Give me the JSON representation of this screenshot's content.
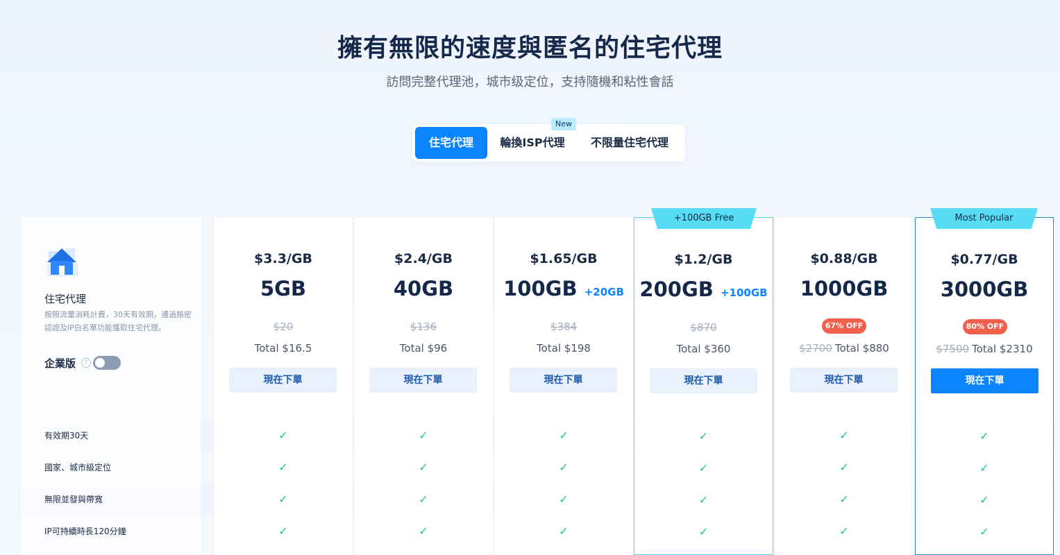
{
  "hero": {
    "title": "擁有無限的速度與匿名的住宅代理",
    "subtitle": "訪問完整代理池，城市级定位，支持隨機和粘性會話"
  },
  "tabs": [
    {
      "label": "住宅代理",
      "active": true
    },
    {
      "label": "輪換ISP代理",
      "active": false,
      "badge": "New"
    },
    {
      "label": "不限量住宅代理",
      "active": false
    }
  ],
  "product": {
    "icon": "house-icon",
    "title": "住宅代理",
    "description": "按照流量消耗計費，30天有效期，通過賬密認證及IP白名單功能獲取住宅代理。",
    "enterprise_label": "企業版",
    "enterprise_toggle": false
  },
  "features": [
    "有效期30天",
    "國家、城市級定位",
    "無限並發與帶寬",
    "IP可持續時長120分鐘"
  ],
  "plans": [
    {
      "per": "$3.3/GB",
      "size": "5GB",
      "bonus": "",
      "original": "$20",
      "discount": "",
      "total": "Total $16.5",
      "buy": "現在下單"
    },
    {
      "per": "$2.4/GB",
      "size": "40GB",
      "bonus": "",
      "original": "$136",
      "discount": "",
      "total": "Total $96",
      "buy": "現在下單"
    },
    {
      "per": "$1.65/GB",
      "size": "100GB",
      "bonus": "+20GB",
      "original": "$384",
      "discount": "",
      "total": "Total $198",
      "buy": "現在下單"
    },
    {
      "per": "$1.2/GB",
      "size": "200GB",
      "bonus": "+100GB",
      "original": "$870",
      "discount": "",
      "total": "Total $360",
      "buy": "現在下單",
      "ribbon": "+100GB Free"
    },
    {
      "per": "$0.88/GB",
      "size": "1000GB",
      "bonus": "",
      "original": "$2700",
      "discount": "67% OFF",
      "total": "Total $880",
      "buy": "現在下單"
    },
    {
      "per": "$0.77/GB",
      "size": "3000GB",
      "bonus": "",
      "original": "$7500",
      "discount": "80% OFF",
      "total": "Total $2310",
      "buy": "現在下單",
      "ribbon": "Most Popular"
    }
  ],
  "check_glyph": "✓",
  "help_glyph": "?",
  "colors": {
    "accent": "#0b84ff",
    "check": "#22c48b",
    "discount": "#f2604d",
    "ribbon": "#56dcf4"
  }
}
